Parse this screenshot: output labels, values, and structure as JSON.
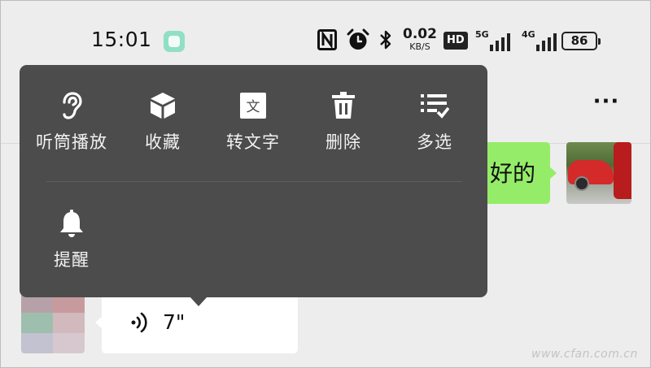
{
  "status_bar": {
    "time": "15:01",
    "network_speed": {
      "value": "0.02",
      "unit": "KB/S"
    },
    "hd_label": "HD",
    "sim1_label": "5G",
    "sim2_label": "4G",
    "battery": "86",
    "icons": [
      "app-notification-icon",
      "nfc-icon",
      "alarm-icon",
      "bluetooth-icon",
      "signal-icon",
      "battery-icon"
    ]
  },
  "header": {
    "more_label": "···"
  },
  "messages": {
    "outgoing_text": "好的",
    "incoming_voice_duration": "7\""
  },
  "context_menu": {
    "items": [
      {
        "label": "听筒播放",
        "icon": "ear-icon"
      },
      {
        "label": "收藏",
        "icon": "cube-icon"
      },
      {
        "label": "转文字",
        "icon": "text-icon",
        "glyph": "文"
      },
      {
        "label": "删除",
        "icon": "trash-icon"
      },
      {
        "label": "多选",
        "icon": "multi-select-icon"
      },
      {
        "label": "提醒",
        "icon": "bell-icon"
      }
    ]
  },
  "colors": {
    "background": "#ededed",
    "menu_background": "#4c4c4c",
    "menu_text": "#f2f2f2",
    "outgoing_bubble": "#95ec69",
    "incoming_bubble": "#ffffff",
    "app_icon": "#8fe0c4"
  },
  "watermark": "www.cfan.com.cn"
}
